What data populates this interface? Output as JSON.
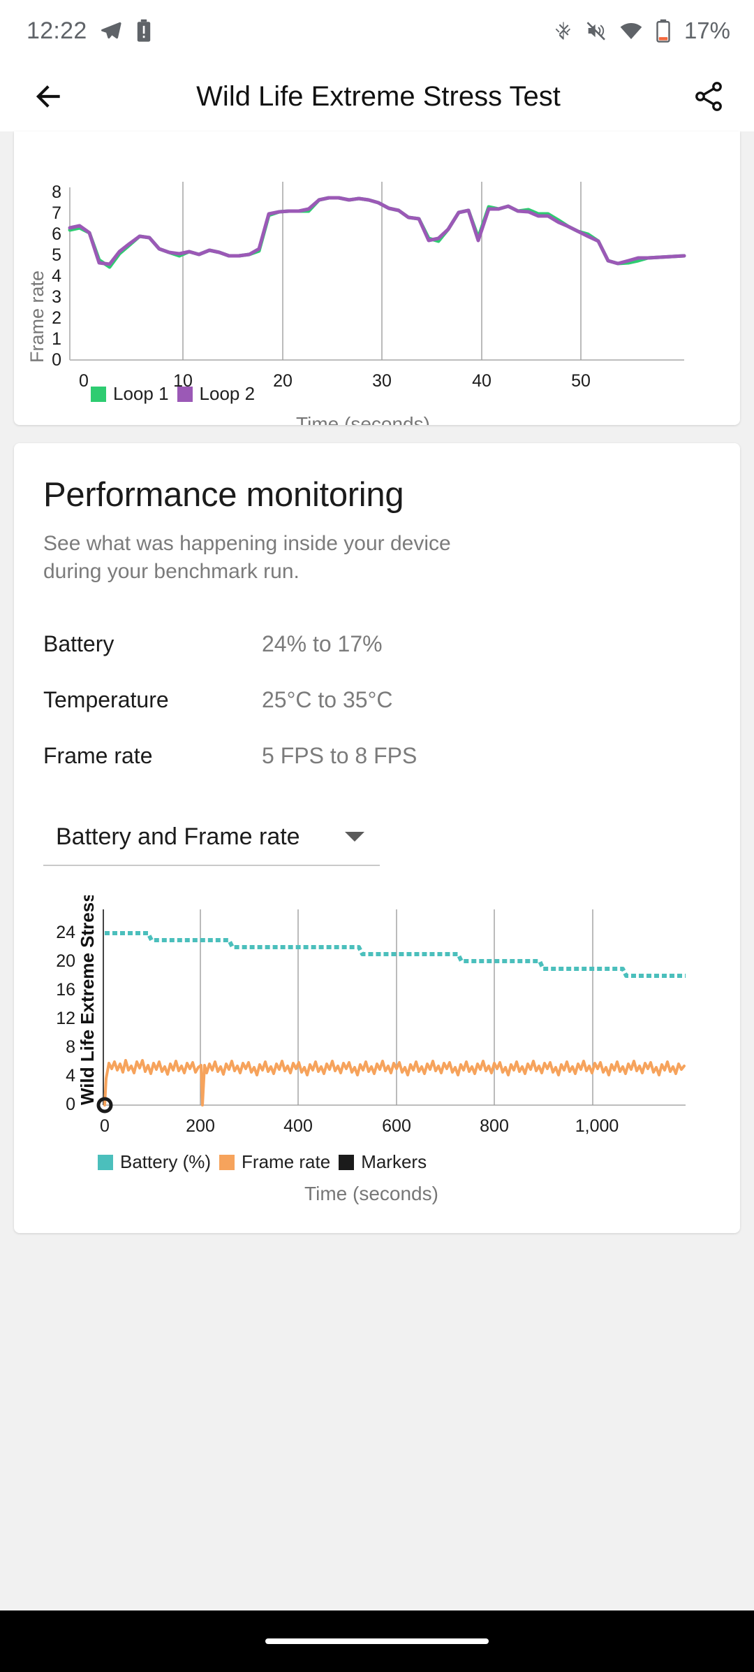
{
  "status_bar": {
    "time": "12:22",
    "battery_percent": "17%",
    "icons": [
      "telegram-icon",
      "battery-alert-icon",
      "bluetooth-icon",
      "mute-icon",
      "wifi-icon",
      "battery-icon"
    ]
  },
  "app_bar": {
    "back_label": "←",
    "title": "Wild Life Extreme Stress Test",
    "share_label": "share"
  },
  "perf": {
    "title": "Performance monitoring",
    "subtitle": "See what was happening inside your device during your benchmark run.",
    "stats": [
      {
        "key": "Battery",
        "value": "24% to 17%"
      },
      {
        "key": "Temperature",
        "value": "25°C to 35°C"
      },
      {
        "key": "Frame rate",
        "value": "5 FPS to 8 FPS"
      }
    ],
    "dropdown": {
      "selected": "Battery and Frame rate",
      "options": [
        "Battery and Frame rate"
      ]
    }
  },
  "nav_bar": {
    "pill": "home-pill"
  },
  "colors": {
    "loop1": "#2ecc71",
    "loop2": "#9b59b6",
    "battery": "#4bbfbc",
    "frame_rate": "#f6a35c",
    "markers": "#1b1b1b",
    "grid": "#9e9e9e",
    "axis": "#bdbdbd"
  },
  "chart_data": [
    {
      "id": "frame-rate-loops",
      "type": "line",
      "title": "",
      "xlabel": "Time (seconds)",
      "ylabel": "Frame rate",
      "xlim": [
        0,
        59
      ],
      "ylim": [
        0,
        8.6
      ],
      "xticks": [
        0,
        10,
        20,
        30,
        40,
        50
      ],
      "yticks": [
        0,
        1,
        2,
        3,
        4,
        5,
        6,
        7,
        8
      ],
      "grid": "vertical",
      "legend": [
        "Loop 1",
        "Loop 2"
      ],
      "legend_position": "bottom-left",
      "series": [
        {
          "name": "Loop 1",
          "color": "#2ecc71",
          "x": [
            0,
            1,
            2,
            3,
            4,
            5,
            6,
            7,
            8,
            9,
            10,
            11,
            12,
            13,
            14,
            15,
            16,
            17,
            18,
            19,
            20,
            21,
            22,
            23,
            24,
            25,
            26,
            27,
            28,
            29,
            30,
            31,
            32,
            33,
            34,
            35,
            36,
            37,
            38,
            39,
            40,
            41,
            42,
            43,
            44,
            45,
            46,
            47,
            48,
            49,
            50,
            51,
            52,
            53,
            54,
            55,
            56,
            57,
            58,
            59
          ],
          "values": [
            6.2,
            6.3,
            6.1,
            5.4,
            4.8,
            5.2,
            5.6,
            5.9,
            5.8,
            5.5,
            5.3,
            5.2,
            5.4,
            5.3,
            5.5,
            5.4,
            5.3,
            5.3,
            5.3,
            5.4,
            6.9,
            7.1,
            7.1,
            7.1,
            7.1,
            7.6,
            7.7,
            7.7,
            7.6,
            7.7,
            7.6,
            7.5,
            7.3,
            7.2,
            7.0,
            6.9,
            6.2,
            6.1,
            6.5,
            7.1,
            7.2,
            6.2,
            7.4,
            7.3,
            7.4,
            7.2,
            7.3,
            7.1,
            7.1,
            6.9,
            6.6,
            6.4,
            6.3,
            6.0,
            5.2,
            5.1,
            5.1,
            5.2,
            5.3,
            5.4
          ]
        },
        {
          "name": "Loop 2",
          "color": "#9b59b6",
          "x": [
            0,
            1,
            2,
            3,
            4,
            5,
            6,
            7,
            8,
            9,
            10,
            11,
            12,
            13,
            14,
            15,
            16,
            17,
            18,
            19,
            20,
            21,
            22,
            23,
            24,
            25,
            26,
            27,
            28,
            29,
            30,
            31,
            32,
            33,
            34,
            35,
            36,
            37,
            38,
            39,
            40,
            41,
            42,
            43,
            44,
            45,
            46,
            47,
            48,
            49,
            50,
            51,
            52,
            53,
            54,
            55,
            56,
            57,
            58,
            59
          ],
          "values": [
            6.3,
            6.4,
            6.1,
            5.3,
            4.9,
            5.3,
            5.7,
            5.9,
            5.8,
            5.5,
            5.3,
            5.3,
            5.4,
            5.3,
            5.5,
            5.4,
            5.3,
            5.3,
            5.3,
            5.5,
            7.0,
            7.1,
            7.1,
            7.1,
            7.2,
            7.6,
            7.7,
            7.7,
            7.6,
            7.7,
            7.6,
            7.5,
            7.3,
            7.2,
            7.0,
            6.9,
            6.1,
            6.2,
            6.5,
            7.1,
            7.2,
            6.1,
            7.3,
            7.3,
            7.4,
            7.2,
            7.2,
            7.0,
            7.0,
            6.8,
            6.6,
            6.4,
            6.2,
            6.0,
            5.2,
            5.1,
            5.2,
            5.3,
            5.3,
            5.4
          ]
        }
      ]
    },
    {
      "id": "battery-and-frame-rate",
      "type": "line",
      "title": "",
      "xlabel": "Time (seconds)",
      "ylabel": "Wild Life Extreme Stress Test",
      "xlim": [
        0,
        1180
      ],
      "ylim": [
        0,
        26
      ],
      "xticks": [
        0,
        200,
        400,
        600,
        800,
        1000
      ],
      "xtick_labels": [
        "0",
        "200",
        "400",
        "600",
        "800",
        "1,000"
      ],
      "yticks": [
        0,
        4,
        8,
        12,
        16,
        20,
        24
      ],
      "grid": "vertical",
      "legend": [
        "Battery (%)",
        "Frame rate",
        "Markers"
      ],
      "legend_position": "bottom-left",
      "series": [
        {
          "name": "Battery (%)",
          "color": "#4bbfbc",
          "style": "step",
          "x": [
            0,
            90,
            95,
            260,
            265,
            520,
            525,
            720,
            725,
            890,
            895,
            1060,
            1065,
            1180
          ],
          "values": [
            24,
            24,
            23,
            23,
            22,
            22,
            21,
            21,
            20,
            20,
            19,
            19,
            18,
            18
          ]
        },
        {
          "name": "Frame rate",
          "color": "#f6a35c",
          "style": "noisy",
          "mean": 5.6,
          "amplitude": 1.4,
          "dropouts": [
            {
              "x": 232,
              "value": 0
            }
          ],
          "x_range": [
            0,
            1180
          ]
        },
        {
          "name": "Markers",
          "color": "#1b1b1b",
          "style": "marker",
          "points": [
            {
              "x": 0,
              "y": 0
            }
          ]
        }
      ]
    }
  ]
}
